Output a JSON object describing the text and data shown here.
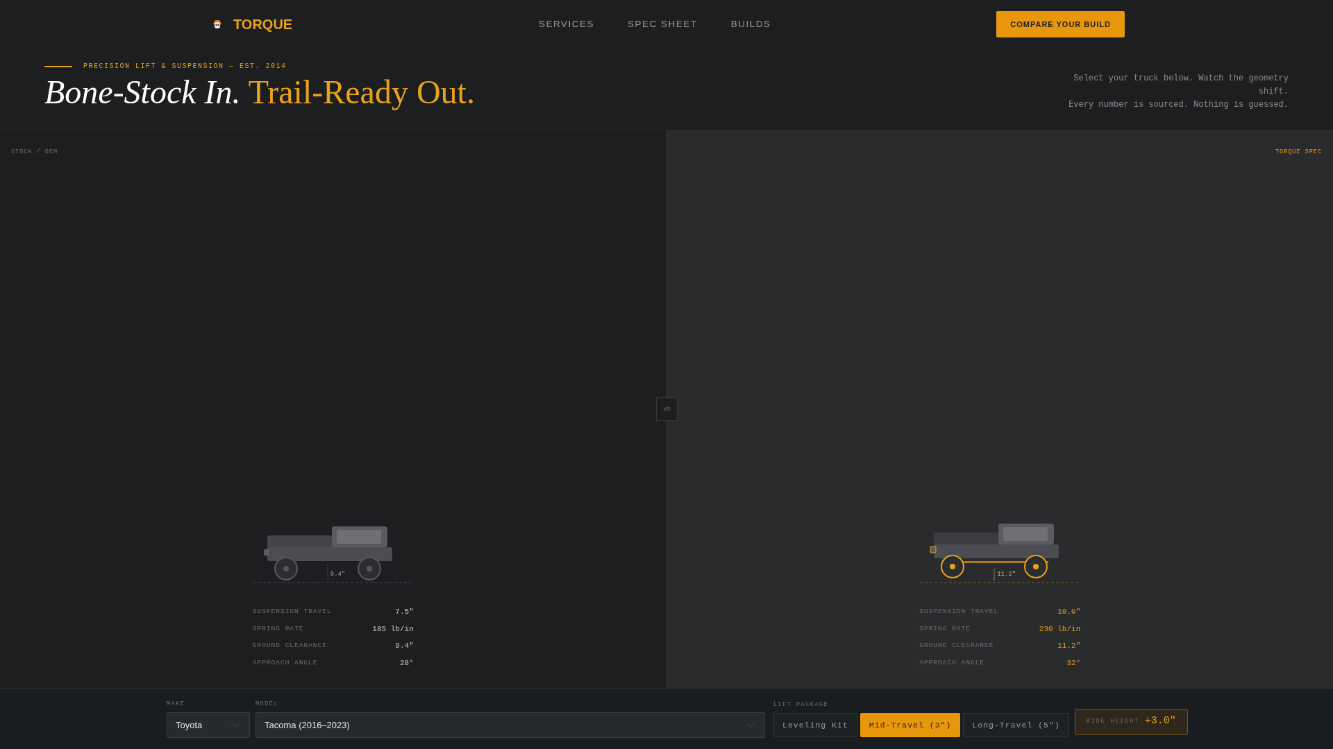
{
  "brand": {
    "name": "TORQUE"
  },
  "nav": [
    {
      "label": "SERVICES"
    },
    {
      "label": "SPEC SHEET"
    },
    {
      "label": "BUILDS"
    }
  ],
  "cta": "COMPARE YOUR BUILD",
  "hero": {
    "eyebrow": "PRECISION LIFT & SUSPENSION — EST. 2014",
    "headline_plain": "Bone-Stock In.",
    "headline_accent": "Trail-Ready Out.",
    "blurb": [
      "Select your truck below. Watch the geometry shift.",
      "Every number is sourced. Nothing is guessed."
    ]
  },
  "vs": "VS",
  "panels": [
    {
      "kind": "stock",
      "label": "STOCK / OEM",
      "clearance": "9.4\"",
      "stats": [
        {
          "label": "SUSPENSION TRAVEL",
          "value": "7.5\""
        },
        {
          "label": "SPRING RATE",
          "value": "185 lb/in"
        },
        {
          "label": "GROUND CLEARANCE",
          "value": "9.4\""
        },
        {
          "label": "APPROACH ANGLE",
          "value": "28°"
        }
      ]
    },
    {
      "kind": "lifted",
      "label": "TORQUE SPEC",
      "clearance": "11.2\"",
      "stats": [
        {
          "label": "SUSPENSION TRAVEL",
          "value": "10.0\""
        },
        {
          "label": "SPRING RATE",
          "value": "230 lb/in"
        },
        {
          "label": "GROUND CLEARANCE",
          "value": "11.2\""
        },
        {
          "label": "APPROACH ANGLE",
          "value": "32°"
        }
      ]
    }
  ],
  "controls": {
    "make": {
      "label": "MAKE",
      "value": "Toyota"
    },
    "model": {
      "label": "MODEL",
      "value": "Tacoma (2016–2023)"
    },
    "lift_package": {
      "label": "LIFT PACKAGE",
      "options": [
        {
          "label": "Leveling Kit",
          "selected": false
        },
        {
          "label": "Mid-Travel (3\")",
          "selected": true
        },
        {
          "label": "Long-Travel (5\")",
          "selected": false
        }
      ]
    },
    "ride_height": {
      "label": "RIDE HEIGHT",
      "value": "+3.0\""
    }
  }
}
